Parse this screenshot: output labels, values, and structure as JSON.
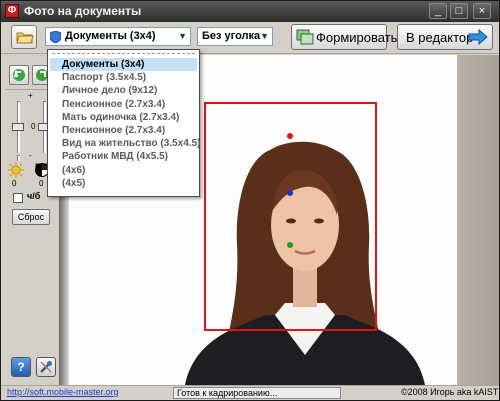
{
  "window": {
    "title": "Фото на документы",
    "app_icon_letter": "Ф"
  },
  "toolbar": {
    "document_combo_value": "Документы (3x4)",
    "corner_combo_value": "Без уголка",
    "form_button_label": "Формировать",
    "editor_button_label": "В редактор"
  },
  "dropdown": {
    "items": [
      "Документы (3x4)",
      "Паспорт (3.5x4.5)",
      "Личное дело (9x12)",
      "Пенсионное (2.7x3.4)",
      "Мать одиночка (2.7x3.4)",
      "Пенсионное (2.7x3.4)",
      "Вид на жительство (3.5x4.5)",
      "Работник МВД (4x5.5)",
      "(4x6)",
      "(4x5)"
    ],
    "selected_index": 0
  },
  "left_panel": {
    "plus_label": "+",
    "minus_label": "-",
    "slider_left_value": "0",
    "slider_right_value": "0",
    "brightness_value": "0",
    "contrast_value": "0",
    "bw_checkbox_label": "ч/б",
    "bw_checked": false,
    "reset_label": "Сброс"
  },
  "statusbar": {
    "link": "http://soft.mobile-master.org",
    "status": "Готов к кадрированию...",
    "copyright": "©2008 Игорь aka kAIST"
  },
  "colors": {
    "crop_frame": "#e01414",
    "selected_item": "#c5dff5",
    "marker_top": "#e01414",
    "marker_eyes": "#1a2fd0",
    "marker_chin": "#1aa020"
  }
}
